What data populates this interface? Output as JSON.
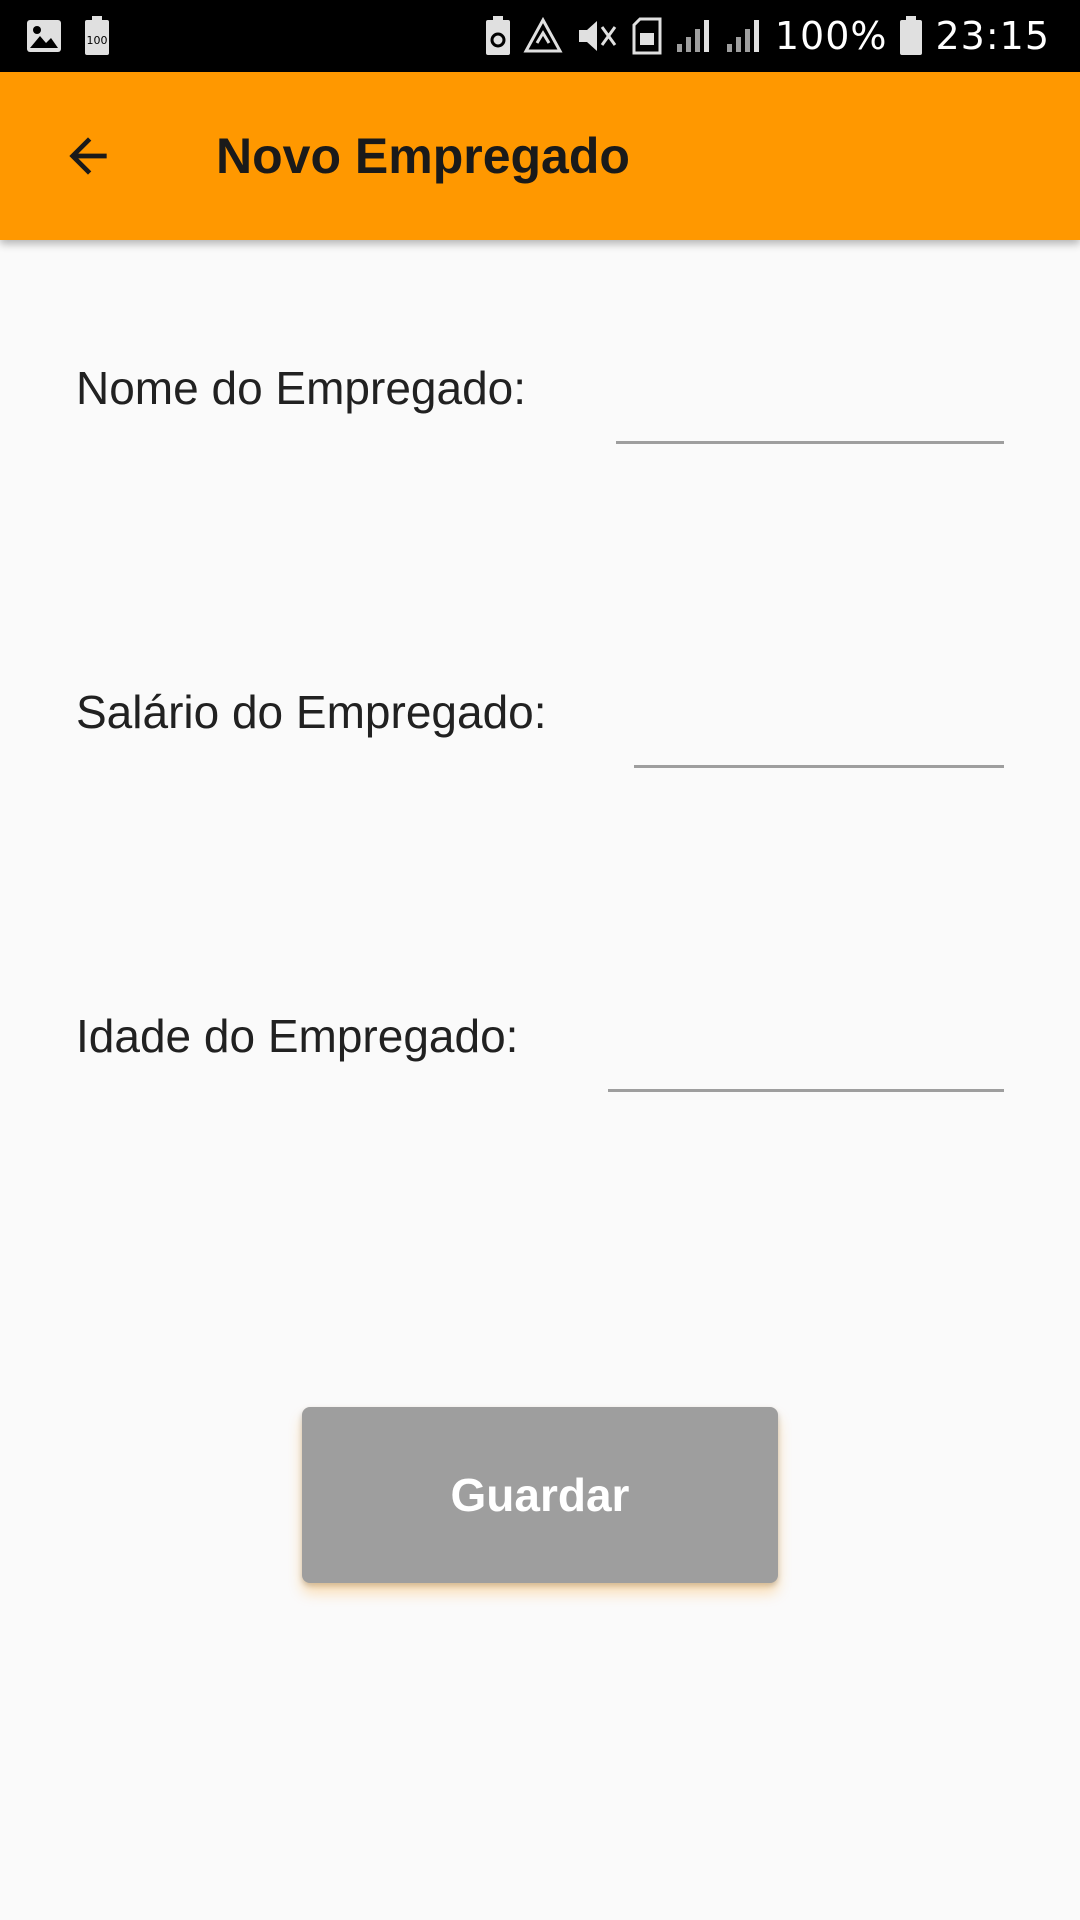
{
  "status_bar": {
    "battery_percent": "100%",
    "time": "23:15",
    "left_icons": [
      "image-icon",
      "battery-100-icon"
    ],
    "right_icons": [
      "battery-saver-icon",
      "recycle-icon",
      "vibrate-mute-icon",
      "sim-card-icon",
      "signal-icon",
      "signal-icon",
      "battery-icon"
    ]
  },
  "app_bar": {
    "title": "Novo Empregado",
    "back_icon": "arrow-left-icon",
    "color": "#ff9800"
  },
  "form": {
    "fields": [
      {
        "label": "Nome do Empregado:",
        "value": "",
        "placeholder": ""
      },
      {
        "label": "Salário do Empregado:",
        "value": "",
        "placeholder": ""
      },
      {
        "label": "Idade do Empregado:",
        "value": "",
        "placeholder": ""
      }
    ]
  },
  "save_button": {
    "label": "Guardar",
    "color": "#9e9e9e"
  }
}
